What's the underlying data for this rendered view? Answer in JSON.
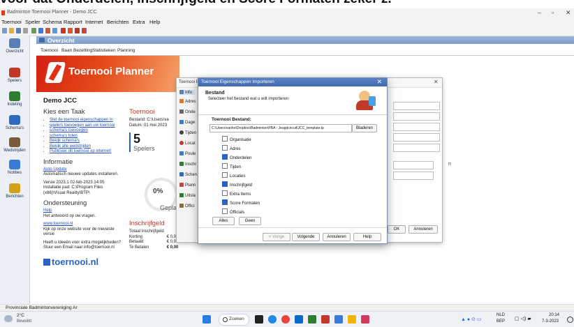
{
  "caption": {
    "pre": "voor dat ",
    "b1": "Onderdelen",
    "mid": ", ",
    "b2": "Inschrijfgeld",
    "post": " en ",
    "b3": "Score Formaten",
    "tail": " zeker z."
  },
  "window": {
    "title": "Badminton Toernooi Planner - Demo JCC"
  },
  "menu": [
    "Toernooi",
    "Speler",
    "Schema",
    "Rapport",
    "Internet",
    "Berichten",
    "Extra",
    "Help"
  ],
  "sidebar": [
    {
      "label": "Overzicht",
      "color": "#5a7fb5"
    },
    {
      "label": "Spelers",
      "color": "#c0392b"
    },
    {
      "label": "Indeling",
      "color": "#2e7d32"
    },
    {
      "label": "Schema's",
      "color": "#2e6bc0"
    },
    {
      "label": "Wedstrijden",
      "color": "#7a5c3c"
    },
    {
      "label": "Notities",
      "color": "#3a7bd5"
    },
    {
      "label": "Berichten",
      "color": "#d4a017"
    }
  ],
  "header": {
    "title": "Overzicht"
  },
  "tabs": [
    "Toernooi",
    "Baan Bezetting",
    "Statistieken",
    "Planning"
  ],
  "banner": {
    "title": "Toernooi Planner"
  },
  "page": {
    "title": "Demo JCC"
  },
  "left": {
    "task_heading": "Kies een Taak",
    "tasks": [
      "Stel de toernooi eigenschappen in",
      "spelers toevoegen aan uw toernooi",
      "schema's toevoegen",
      "schema's loten",
      "Bekijk schema's",
      "Bekijk alle wedstrijden",
      "Publiceer dit toernooi op internet!"
    ],
    "info_heading": "Informatie",
    "auto_update": "Auto-Update",
    "auto_update_text": "Automatisch nieuwe updates installeren.",
    "version": "Versie 2023.1 02-feb-2023 14:05",
    "install_path": "Installatie pad: C:\\Program Files (x86)\\Visual Reality\\BTP\\",
    "support_heading": "Ondersteuning",
    "help_link": "Help",
    "help_text": "Het antwoord op uw vragen.",
    "site_link": "www.toernooi.nl",
    "site_text": "Kijk op onze website voor de nieuwste versie",
    "idea_text": "Heeft u ideeën voor extra mogelijkheden? Stuur een Email naar info@toernooi.nl",
    "footer_logo": "toernooi.nl"
  },
  "mid": {
    "heading": "Toernooi",
    "file": "Bestand: C:\\Users\\va",
    "date": "Datum: 01 mei 2023",
    "players_count": "5",
    "players_label": "Spelers",
    "percent": "0%",
    "planned_label": "Gepland",
    "fee_heading": "Inschrijfgeld",
    "fees": [
      {
        "label": "Totaal Inschrijfgeld",
        "value": ""
      },
      {
        "label": "Korting",
        "value": "€ 0,00"
      },
      {
        "label": "Betaald",
        "value": "€ 0,00"
      },
      {
        "label": "Te Betalen",
        "value": "€ 0,00"
      }
    ]
  },
  "bg_window": {
    "title": "Toernooi E",
    "items": [
      "Info",
      "Adres",
      "Onde",
      "Dage",
      "Tijden",
      "Locat",
      "Poule",
      "Inschr",
      "Schen",
      "Plann",
      "Uitsla",
      "Offici"
    ],
    "ok": "OK",
    "cancel": "Annuleren"
  },
  "dialog": {
    "title": "Toernooi Eigenschappen Importeren",
    "section": "Bestand",
    "subtitle": "Selecteer het bestand wat u wilt importeren",
    "file_label": "Toernooi Bestand:",
    "file_path": "C:\\Users\\vanho\\Dropbox\\Badminton\\PBA - Jeugdcircuit\\JCC_template.tp",
    "browse": "Bladeren",
    "options": [
      {
        "label": "Organisatie",
        "checked": false
      },
      {
        "label": "Adres",
        "checked": false
      },
      {
        "label": "Onderdelen",
        "checked": true
      },
      {
        "label": "Tijden",
        "checked": false
      },
      {
        "label": "Locaties",
        "checked": false
      },
      {
        "label": "Inschrijfgeld",
        "checked": true
      },
      {
        "label": "Extra Items",
        "checked": false
      },
      {
        "label": "Score Formaten",
        "checked": true
      },
      {
        "label": "Officials",
        "checked": false
      }
    ],
    "all": "Alles",
    "none": "Geen",
    "prev": "< Vorige",
    "next": "Volgende",
    "cancel": "Annuleren",
    "help": "Help"
  },
  "status": {
    "text": "Provinciale Badmintonvereniging Ar"
  },
  "taskbar": {
    "weather_temp": "2°C",
    "weather_text": "Bewolkt",
    "search": "Zoeken",
    "lang": "NLD",
    "lang2": "BEP",
    "time": "20:14",
    "date": "7-3-2023"
  }
}
